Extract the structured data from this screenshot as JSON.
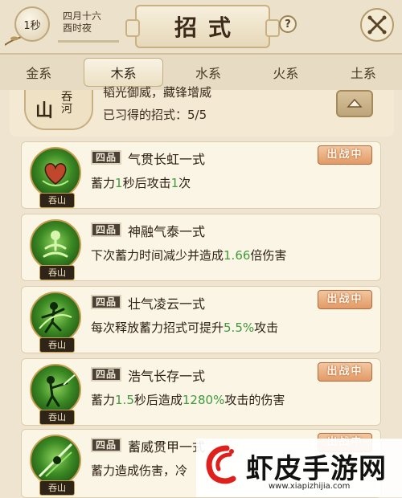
{
  "header": {
    "time_badge": "1秒",
    "date_line1": "四月十六",
    "date_line2": "酉时夜",
    "title": "招式",
    "help_glyph": "?"
  },
  "tabs": [
    {
      "label": "金系",
      "active": false
    },
    {
      "label": "木系",
      "active": true
    },
    {
      "label": "水系",
      "active": false
    },
    {
      "label": "火系",
      "active": false
    },
    {
      "label": "土系",
      "active": false
    }
  ],
  "info": {
    "emblem_big": "山",
    "emblem_small": "吞河",
    "line1": "韬光御威，藏锋增威",
    "line2": "已习得的招式：5/5"
  },
  "skills": [
    {
      "grade": "四品",
      "name": "气贯长虹一式",
      "desc_parts": [
        "蓄力",
        "1",
        "秒后攻击",
        "1",
        "次"
      ],
      "status": "出战中",
      "portrait_label": "吞山",
      "icon": "heart-icon"
    },
    {
      "grade": "四品",
      "name": "神融气泰一式",
      "desc_parts": [
        "下次蓄力时间减少并造成",
        "1.66",
        "倍伤害",
        "",
        ""
      ],
      "status": "",
      "portrait_label": "吞山",
      "icon": "meditation-icon"
    },
    {
      "grade": "四品",
      "name": "壮气凌云一式",
      "desc_parts": [
        "每次释放蓄力招式可提升",
        "5.5%",
        "攻击",
        "",
        ""
      ],
      "status": "出战中",
      "portrait_label": "吞山",
      "icon": "dancer-icon"
    },
    {
      "grade": "四品",
      "name": "浩气长存一式",
      "desc_parts": [
        "蓄力",
        "1.5",
        "秒后造成",
        "1280%",
        "攻击的伤害"
      ],
      "status": "出战中",
      "portrait_label": "吞山",
      "icon": "swordsman-icon"
    },
    {
      "grade": "四品",
      "name": "蓄威贯甲一式",
      "desc_parts": [
        "蓄力造成伤害，冷",
        "",
        "",
        "",
        ""
      ],
      "status": "出战中",
      "portrait_label": "吞山",
      "icon": "strike-icon"
    }
  ],
  "watermark": {
    "title": "虾皮手游网",
    "url": "www.xiapizhijia.com"
  },
  "colors": {
    "highlight_green": "#3f9a3a",
    "badge_orange": "#e29a66",
    "background": "#efe4cf"
  }
}
